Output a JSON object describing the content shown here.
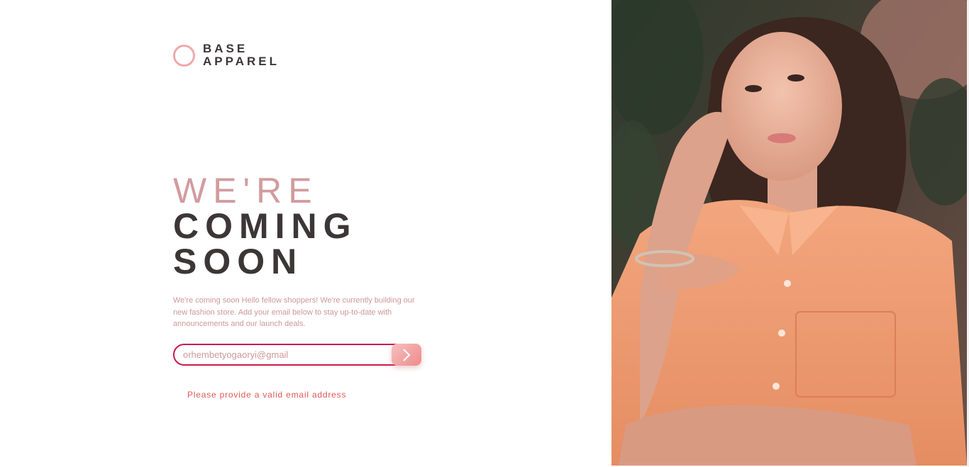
{
  "logo": {
    "line1": "BASE",
    "line2": "APPAREL"
  },
  "headline": {
    "light": "We're",
    "dark_1": "Coming",
    "dark_2": "Soon"
  },
  "description": "We're coming soon Hello fellow shoppers! We're currently building our new fashion store. Add your email below to stay up-to-date with announcements and our launch deals.",
  "form": {
    "email_value": "orhembetyogaoryi@gmail",
    "submit_icon": "chevron-right-icon"
  },
  "error_message": "Please provide a valid email address",
  "colors": {
    "accent_pink": "#ce9898",
    "dark_text": "#3d3637",
    "error_red": "#e15857",
    "input_border": "#cc1a4b"
  },
  "hero_image": "hero-photo-woman-orange-shirt"
}
